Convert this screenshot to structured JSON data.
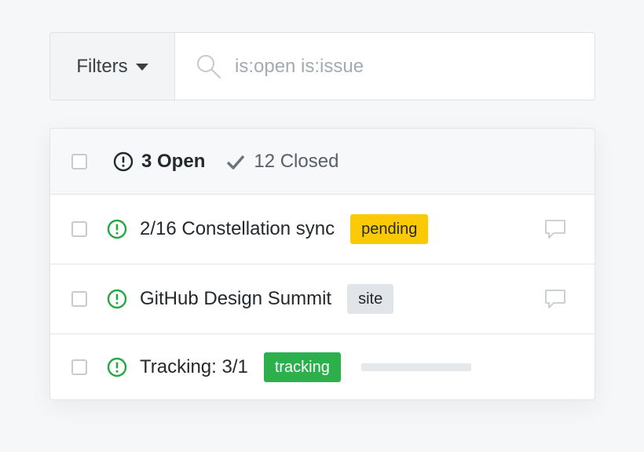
{
  "filter_bar": {
    "filters_label": "Filters",
    "search_value": "",
    "search_placeholder": "is:open is:issue"
  },
  "list_header": {
    "open_label": "3 Open",
    "closed_label": "12 Closed"
  },
  "issues": [
    {
      "title": "2/16 Constellation sync",
      "label": "pending",
      "label_bg": "#fbca04",
      "label_fg": "#24292e",
      "has_comment": true
    },
    {
      "title": "GitHub Design Summit",
      "label": "site",
      "label_bg": "#e1e4e8",
      "label_fg": "#24292e",
      "has_comment": true
    },
    {
      "title": "Tracking: 3/1",
      "label": "tracking",
      "label_bg": "#2cb04c",
      "label_fg": "#ffffff",
      "progress_fraction": 0
    }
  ],
  "colors": {
    "open_icon": "#28a745",
    "header_icon": "#24292e",
    "check": "#6a737d"
  },
  "icons": [
    "caret-down-icon",
    "search-icon",
    "issue-opened-icon",
    "check-icon",
    "comment-icon"
  ]
}
